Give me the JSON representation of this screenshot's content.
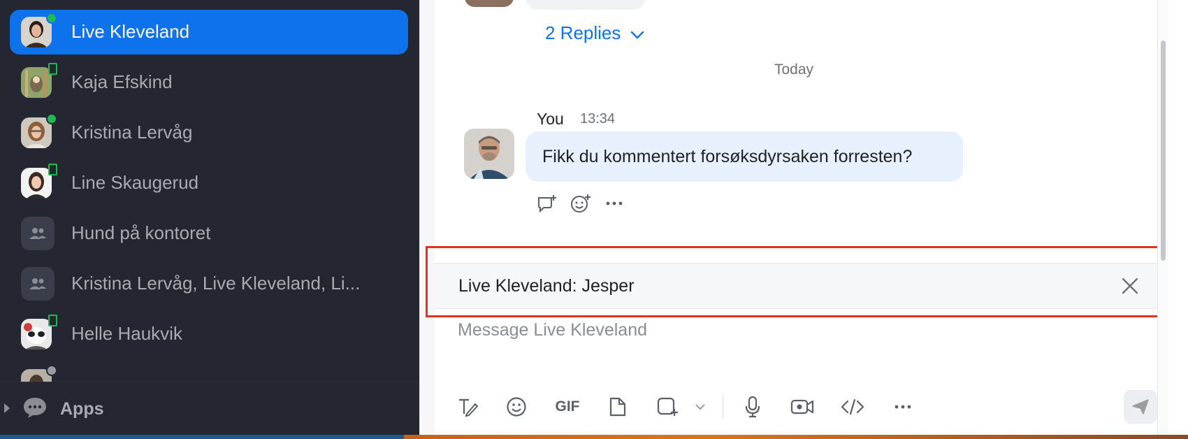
{
  "sidebar": {
    "chats": [
      {
        "name": "Live Kleveland",
        "active": true,
        "presence": "online"
      },
      {
        "name": "Kaja Efskind",
        "active": false,
        "presence": "mobile"
      },
      {
        "name": "Kristina Lervåg",
        "active": false,
        "presence": "online"
      },
      {
        "name": "Line Skaugerud",
        "active": false,
        "presence": "mobile"
      },
      {
        "name": "Hund på kontoret",
        "active": false,
        "presence": "group"
      },
      {
        "name": "Kristina Lervåg, Live Kleveland, Li...",
        "active": false,
        "presence": "group"
      },
      {
        "name": "Helle Haukvik",
        "active": false,
        "presence": "mobile"
      }
    ],
    "apps_label": "Apps"
  },
  "thread": {
    "replies_label": "2 Replies",
    "date_separator": "Today",
    "message": {
      "sender": "You",
      "time": "13:34",
      "text": "Fikk du kommentert forsøksdyrsaken forresten?"
    }
  },
  "compose": {
    "reply_preview": "Live Kleveland: Jesper",
    "placeholder": "Message Live Kleveland",
    "toolbar": [
      "format-icon",
      "emoji-icon",
      "gif-icon",
      "file-icon",
      "screenshot-icon",
      "chevron-down-icon",
      "microphone-icon",
      "video-icon",
      "code-icon",
      "more-icon"
    ],
    "gif_label": "GIF"
  },
  "colors": {
    "sidebar_bg": "#242632",
    "accent": "#0e72ed",
    "bubble": "#e7f1fd",
    "online": "#1db954",
    "highlight": "#e0341e"
  }
}
